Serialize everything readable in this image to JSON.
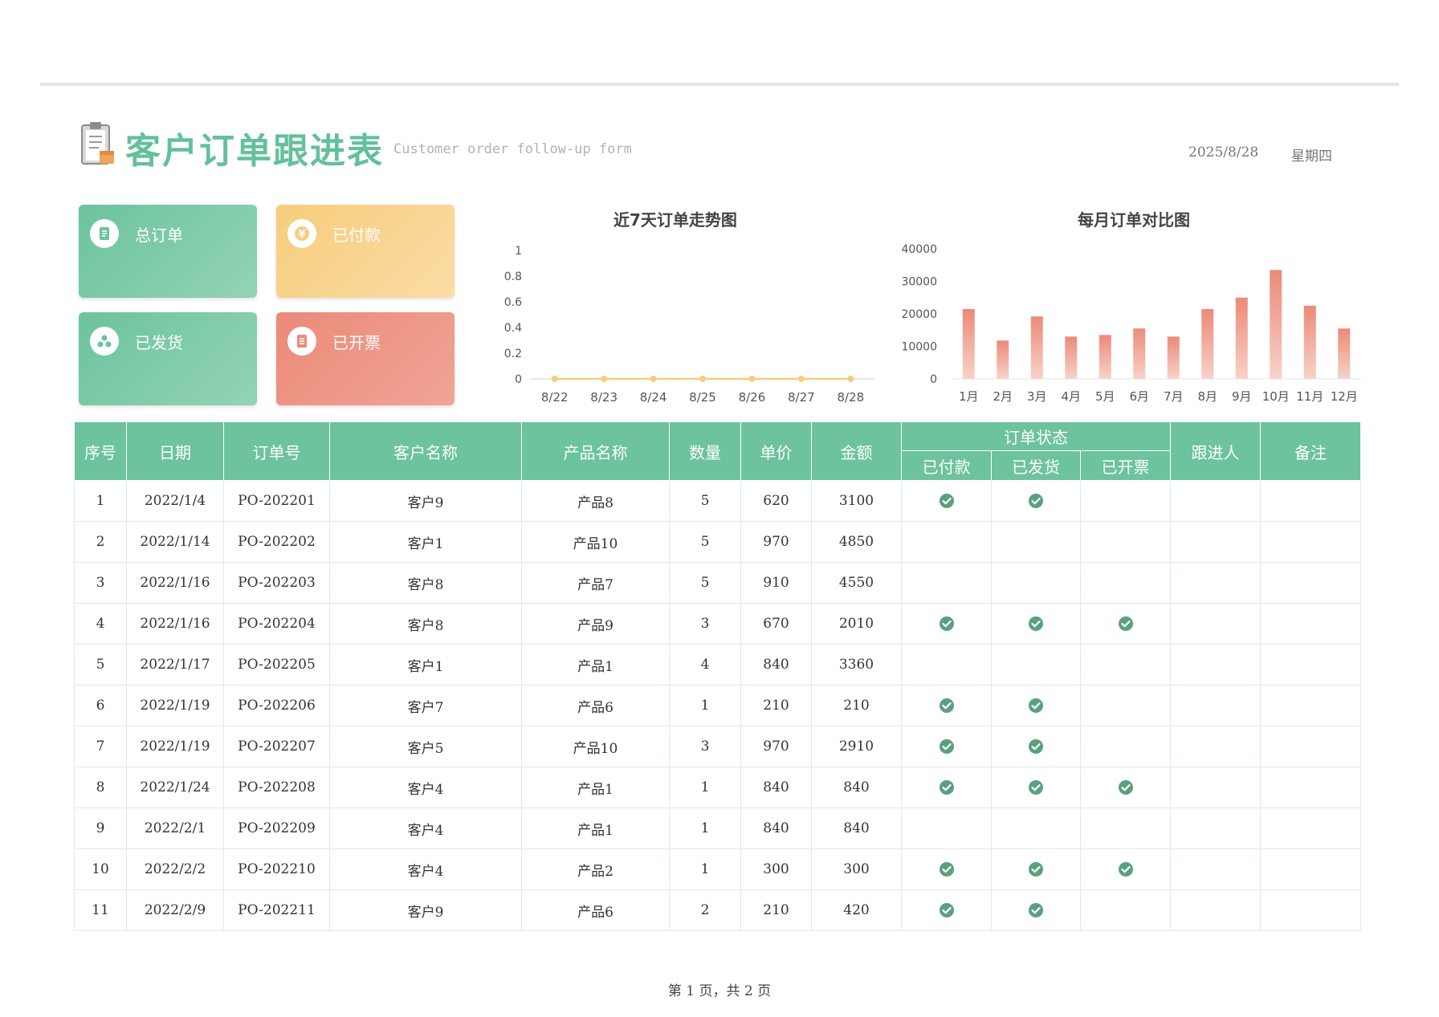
{
  "header": {
    "title": "客户订单跟进表",
    "subtitle": "Customer order follow-up form",
    "date": "2025/8/28",
    "weekday": "星期四",
    "icon": "clipboard-icon"
  },
  "cards": [
    {
      "label": "总订单",
      "icon": "document-icon",
      "color": "#6cc39d"
    },
    {
      "label": "已付款",
      "icon": "yen-icon",
      "color": "#f6cd7d"
    },
    {
      "label": "已发货",
      "icon": "user-group-icon",
      "color": "#6cc39d"
    },
    {
      "label": "已开票",
      "icon": "invoice-icon",
      "color": "#ec8a78"
    }
  ],
  "chart_data": [
    {
      "type": "line",
      "title": "近7天订单走势图",
      "categories": [
        "8/22",
        "8/23",
        "8/24",
        "8/25",
        "8/26",
        "8/27",
        "8/28"
      ],
      "values": [
        0,
        0,
        0,
        0,
        0,
        0,
        0
      ],
      "ylim": [
        0,
        1
      ],
      "yticks": [
        "0",
        "0.2",
        "0.4",
        "0.6",
        "0.8",
        "1"
      ],
      "color": "#f6cd7d"
    },
    {
      "type": "bar",
      "title": "每月订单对比图",
      "categories": [
        "1月",
        "2月",
        "3月",
        "4月",
        "5月",
        "6月",
        "7月",
        "8月",
        "9月",
        "10月",
        "11月",
        "12月"
      ],
      "values": [
        21500,
        11800,
        19200,
        13000,
        13500,
        15500,
        13000,
        21500,
        25000,
        33500,
        22500,
        15500
      ],
      "ylim": [
        0,
        40000
      ],
      "yticks": [
        "0",
        "10000",
        "20000",
        "30000",
        "40000"
      ],
      "color": "#ec8a78"
    }
  ],
  "table": {
    "headers": {
      "seq": "序号",
      "date": "日期",
      "order_no": "订单号",
      "customer": "客户名称",
      "product": "产品名称",
      "qty": "数量",
      "price": "单价",
      "amount": "金额",
      "status": "订单状态",
      "paid": "已付款",
      "shipped": "已发货",
      "invoiced": "已开票",
      "follower": "跟进人",
      "remark": "备注"
    },
    "rows": [
      {
        "seq": "1",
        "date": "2022/1/4",
        "order_no": "PO-202201",
        "customer": "客户9",
        "product": "产品8",
        "qty": "5",
        "price": "620",
        "amount": "3100",
        "paid": true,
        "shipped": true,
        "invoiced": false,
        "follower": "",
        "remark": ""
      },
      {
        "seq": "2",
        "date": "2022/1/14",
        "order_no": "PO-202202",
        "customer": "客户1",
        "product": "产品10",
        "qty": "5",
        "price": "970",
        "amount": "4850",
        "paid": false,
        "shipped": false,
        "invoiced": false,
        "follower": "",
        "remark": ""
      },
      {
        "seq": "3",
        "date": "2022/1/16",
        "order_no": "PO-202203",
        "customer": "客户8",
        "product": "产品7",
        "qty": "5",
        "price": "910",
        "amount": "4550",
        "paid": false,
        "shipped": false,
        "invoiced": false,
        "follower": "",
        "remark": ""
      },
      {
        "seq": "4",
        "date": "2022/1/16",
        "order_no": "PO-202204",
        "customer": "客户8",
        "product": "产品9",
        "qty": "3",
        "price": "670",
        "amount": "2010",
        "paid": true,
        "shipped": true,
        "invoiced": true,
        "follower": "",
        "remark": ""
      },
      {
        "seq": "5",
        "date": "2022/1/17",
        "order_no": "PO-202205",
        "customer": "客户1",
        "product": "产品1",
        "qty": "4",
        "price": "840",
        "amount": "3360",
        "paid": false,
        "shipped": false,
        "invoiced": false,
        "follower": "",
        "remark": ""
      },
      {
        "seq": "6",
        "date": "2022/1/19",
        "order_no": "PO-202206",
        "customer": "客户7",
        "product": "产品6",
        "qty": "1",
        "price": "210",
        "amount": "210",
        "paid": true,
        "shipped": true,
        "invoiced": false,
        "follower": "",
        "remark": ""
      },
      {
        "seq": "7",
        "date": "2022/1/19",
        "order_no": "PO-202207",
        "customer": "客户5",
        "product": "产品10",
        "qty": "3",
        "price": "970",
        "amount": "2910",
        "paid": true,
        "shipped": true,
        "invoiced": false,
        "follower": "",
        "remark": ""
      },
      {
        "seq": "8",
        "date": "2022/1/24",
        "order_no": "PO-202208",
        "customer": "客户4",
        "product": "产品1",
        "qty": "1",
        "price": "840",
        "amount": "840",
        "paid": true,
        "shipped": true,
        "invoiced": true,
        "follower": "",
        "remark": ""
      },
      {
        "seq": "9",
        "date": "2022/2/1",
        "order_no": "PO-202209",
        "customer": "客户4",
        "product": "产品1",
        "qty": "1",
        "price": "840",
        "amount": "840",
        "paid": false,
        "shipped": false,
        "invoiced": false,
        "follower": "",
        "remark": ""
      },
      {
        "seq": "10",
        "date": "2022/2/2",
        "order_no": "PO-202210",
        "customer": "客户4",
        "product": "产品2",
        "qty": "1",
        "price": "300",
        "amount": "300",
        "paid": true,
        "shipped": true,
        "invoiced": true,
        "follower": "",
        "remark": ""
      },
      {
        "seq": "11",
        "date": "2022/2/9",
        "order_no": "PO-202211",
        "customer": "客户9",
        "product": "产品6",
        "qty": "2",
        "price": "210",
        "amount": "420",
        "paid": true,
        "shipped": true,
        "invoiced": false,
        "follower": "",
        "remark": ""
      }
    ]
  },
  "footer": {
    "page_text": "第 1 页，共 2 页"
  },
  "colors": {
    "accent": "#62c19a",
    "check": "#5aa07f"
  }
}
